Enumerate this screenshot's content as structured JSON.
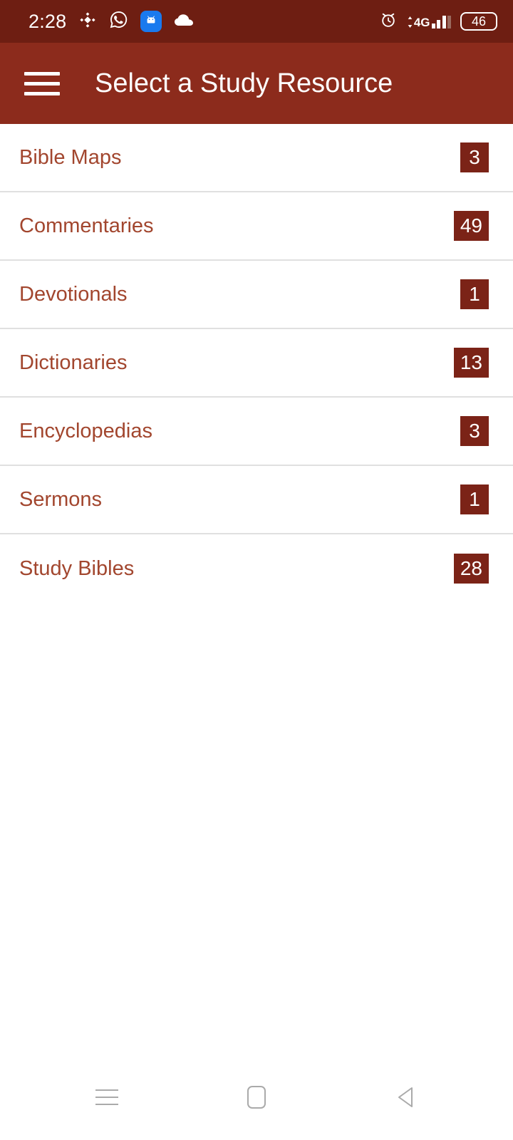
{
  "theme": {
    "status_bar_bg": "#6E1E12",
    "app_bar_bg": "#8C2B1C",
    "item_text": "#A2462E",
    "badge_bg": "#7B2317",
    "badge_text": "#FFFFFF",
    "divider": "#E0E0E0",
    "page_bg": "#FFFFFF",
    "nav_icon": "#AAAAAA"
  },
  "status_bar": {
    "time": "2:28",
    "left_icons": [
      {
        "name": "binance-diamond-icon"
      },
      {
        "name": "whatsapp-icon"
      },
      {
        "name": "android-icon"
      },
      {
        "name": "cloud-icon"
      }
    ],
    "right": {
      "alarm_icon": "alarm-clock-icon",
      "network_type": "4G",
      "signal_icon": "signal-bars-icon",
      "battery_level": "46"
    }
  },
  "app_bar": {
    "menu_icon": "hamburger-menu-icon",
    "title": "Select a Study Resource"
  },
  "resource_list": {
    "items": [
      {
        "label": "Bible Maps",
        "count": "3"
      },
      {
        "label": "Commentaries",
        "count": "49"
      },
      {
        "label": "Devotionals",
        "count": "1"
      },
      {
        "label": "Dictionaries",
        "count": "13"
      },
      {
        "label": "Encyclopedias",
        "count": "3"
      },
      {
        "label": "Sermons",
        "count": "1"
      },
      {
        "label": "Study Bibles",
        "count": "28"
      }
    ]
  },
  "nav_bar": {
    "recents_icon": "recents-menu-icon",
    "home_icon": "home-square-icon",
    "back_icon": "back-triangle-icon"
  }
}
